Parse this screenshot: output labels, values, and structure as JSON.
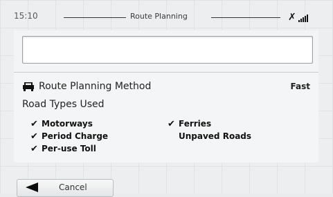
{
  "status_bar": {
    "time": "15:10",
    "title": "Route Planning",
    "satellite_icon": "satellite-icon",
    "signal_icon": "signal-strength-icon"
  },
  "search": {
    "value": "",
    "placeholder": ""
  },
  "settings": {
    "method": {
      "icon": "car-icon",
      "label": "Route Planning Method",
      "value": "Fast"
    },
    "road_types": {
      "label": "Road Types Used",
      "items": [
        {
          "label": "Motorways",
          "checked": true
        },
        {
          "label": "Period Charge",
          "checked": true
        },
        {
          "label": "Per-use Toll",
          "checked": true
        },
        {
          "label": "Ferries",
          "checked": true
        },
        {
          "label": "Unpaved Roads",
          "checked": false
        }
      ]
    }
  },
  "footer": {
    "cancel_label": "Cancel",
    "cancel_icon": "back-arrow-icon"
  },
  "colors": {
    "background": "#eceeef",
    "panel": "#f4f5f6",
    "text": "#222222"
  }
}
